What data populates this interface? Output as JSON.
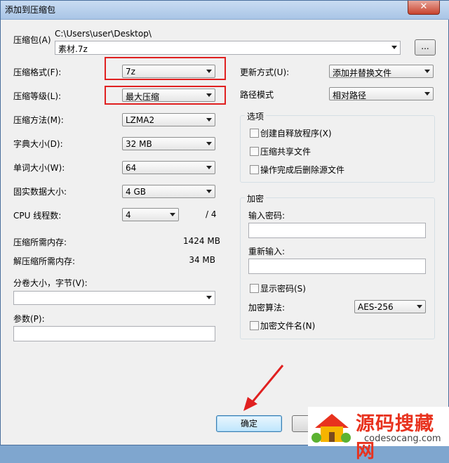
{
  "window": {
    "title": "添加到压缩包",
    "close_glyph": "✕"
  },
  "archive": {
    "label": "压缩包(A)",
    "path": "C:\\Users\\user\\Desktop\\",
    "filename": "素材.7z",
    "browse_label": "..."
  },
  "left": {
    "format": {
      "label": "压缩格式(F):",
      "value": "7z"
    },
    "level": {
      "label": "压缩等级(L):",
      "value": "最大压缩"
    },
    "method": {
      "label": "压缩方法(M):",
      "value": "LZMA2"
    },
    "dict": {
      "label": "字典大小(D):",
      "value": "32 MB"
    },
    "word": {
      "label": "单词大小(W):",
      "value": "64"
    },
    "solid": {
      "label": "固实数据大小:",
      "value": "4 GB"
    },
    "threads": {
      "label": "CPU 线程数:",
      "value": "4",
      "total": "/ 4"
    },
    "mem_compress": {
      "label": "压缩所需内存:",
      "value": "1424 MB"
    },
    "mem_decompress": {
      "label": "解压缩所需内存:",
      "value": "34 MB"
    },
    "volume": {
      "label": "分卷大小，字节(V):",
      "value": ""
    },
    "params": {
      "label": "参数(P):",
      "value": ""
    }
  },
  "right": {
    "update": {
      "label": "更新方式(U):",
      "value": "添加并替换文件"
    },
    "pathmode": {
      "label": "路径模式",
      "value": "相对路径"
    },
    "options": {
      "title": "选项",
      "items": [
        "创建自释放程序(X)",
        "压缩共享文件",
        "操作完成后删除源文件"
      ]
    },
    "encrypt": {
      "title": "加密",
      "password_label": "输入密码:",
      "reenter_label": "重新输入:",
      "show_password": "显示密码(S)",
      "method_label": "加密算法:",
      "method_value": "AES-256",
      "encrypt_names": "加密文件名(N)"
    }
  },
  "buttons": {
    "ok": "确定"
  },
  "watermark": {
    "brand": "源码搜藏网",
    "url": "codesocang.com"
  },
  "colors": {
    "highlight": "#e02020",
    "watermark_red": "#e8321e"
  }
}
